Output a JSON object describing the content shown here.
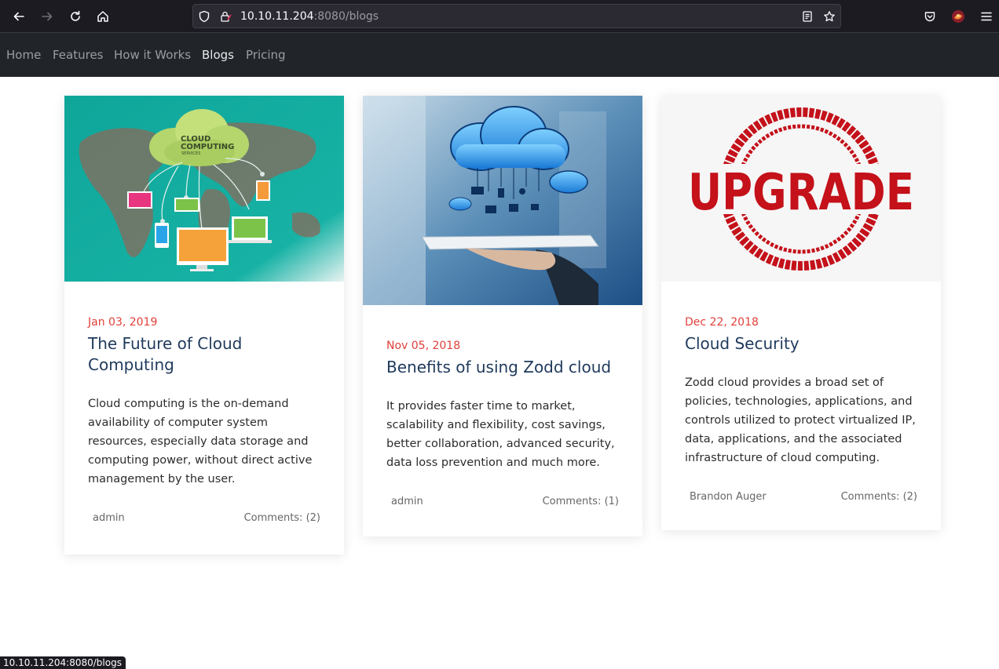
{
  "browser": {
    "url_host": "10.10.11.204",
    "url_rest": ":8080/blogs",
    "icons": [
      "back-icon",
      "forward-icon",
      "reload-icon",
      "home-icon",
      "shield-icon",
      "lock-warning-icon",
      "reader-view-icon",
      "bookmark-star-icon",
      "pocket-icon",
      "profile-icon",
      "menu-icon"
    ]
  },
  "nav": {
    "items": [
      {
        "label": "Home"
      },
      {
        "label": "Features"
      },
      {
        "label": "How it Works"
      },
      {
        "label": "Blogs"
      },
      {
        "label": "Pricing"
      }
    ],
    "active": "Blogs"
  },
  "posts": [
    {
      "date": "Jan 03, 2019",
      "title": "The Future of Cloud Computing",
      "excerpt": "Cloud computing is the on-demand availability of computer system resources, especially data storage and computing power, without direct active management by the user.",
      "author": "admin",
      "comments": "Comments: (2)",
      "image_text": [
        "CLOUD",
        "COMPUTING",
        "SERVICES"
      ]
    },
    {
      "date": "Nov 05, 2018",
      "title": "Benefits of using Zodd cloud",
      "excerpt": "It provides faster time to market, scalability and flexibility, cost savings, better collaboration, advanced security, data loss prevention and much more.",
      "author": "admin",
      "comments": "Comments: (1)"
    },
    {
      "date": "Dec 22, 2018",
      "title": "Cloud Security",
      "excerpt": "Zodd cloud provides a broad set of policies, technologies, applications, and controls utilized to protect virtualized IP, data, applications, and the associated infrastructure of cloud computing.",
      "author": "Brandon Auger",
      "comments": "Comments: (2)",
      "image_text": "UPGRADE"
    }
  ],
  "status_url": "10.10.11.204:8080/blogs",
  "colors": {
    "accent_date": "#e0403a",
    "title": "#1f3a5c",
    "nav_bg": "#212529"
  }
}
